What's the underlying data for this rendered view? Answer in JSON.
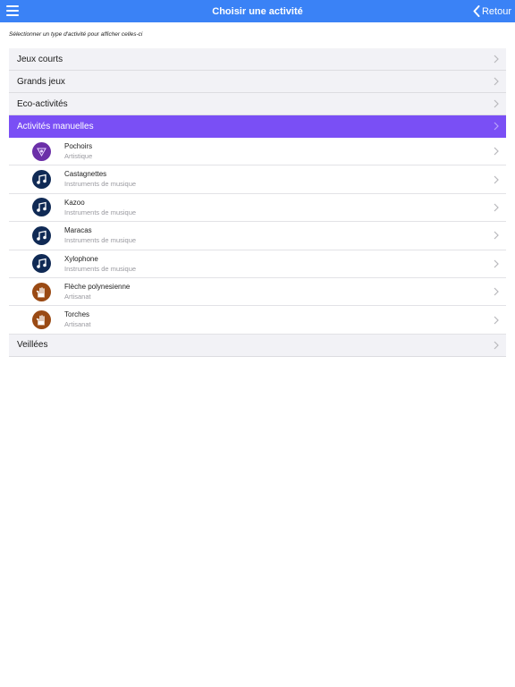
{
  "header": {
    "title": "Choisir une activité",
    "back_label": "Retour"
  },
  "subtitle": "Sélectionner un type d'activité pour afficher celles-ci",
  "categories": [
    {
      "label": "Jeux courts"
    },
    {
      "label": "Grands jeux"
    },
    {
      "label": "Eco-activités"
    },
    {
      "label": "Activités manuelles"
    },
    {
      "label": "Veillées"
    }
  ],
  "activities": [
    {
      "name": "Pochoirs",
      "type": "Artistique",
      "icon": "art-icon"
    },
    {
      "name": "Castagnettes",
      "type": "Instruments de musique",
      "icon": "music-note-icon"
    },
    {
      "name": "Kazoo",
      "type": "Instruments de musique",
      "icon": "music-note-icon"
    },
    {
      "name": "Maracas",
      "type": "Instruments de musique",
      "icon": "music-note-icon"
    },
    {
      "name": "Xylophone",
      "type": "Instruments de musique",
      "icon": "music-note-icon"
    },
    {
      "name": "Flèche polynesienne",
      "type": "Artisanat",
      "icon": "hand-icon"
    },
    {
      "name": "Torches",
      "type": "Artisanat",
      "icon": "hand-icon"
    }
  ],
  "colors": {
    "navbar": "#3a82f6",
    "active_category": "#7a4ff5",
    "art": "#6b2fa8",
    "music": "#102a55",
    "craft": "#9a4a14"
  }
}
